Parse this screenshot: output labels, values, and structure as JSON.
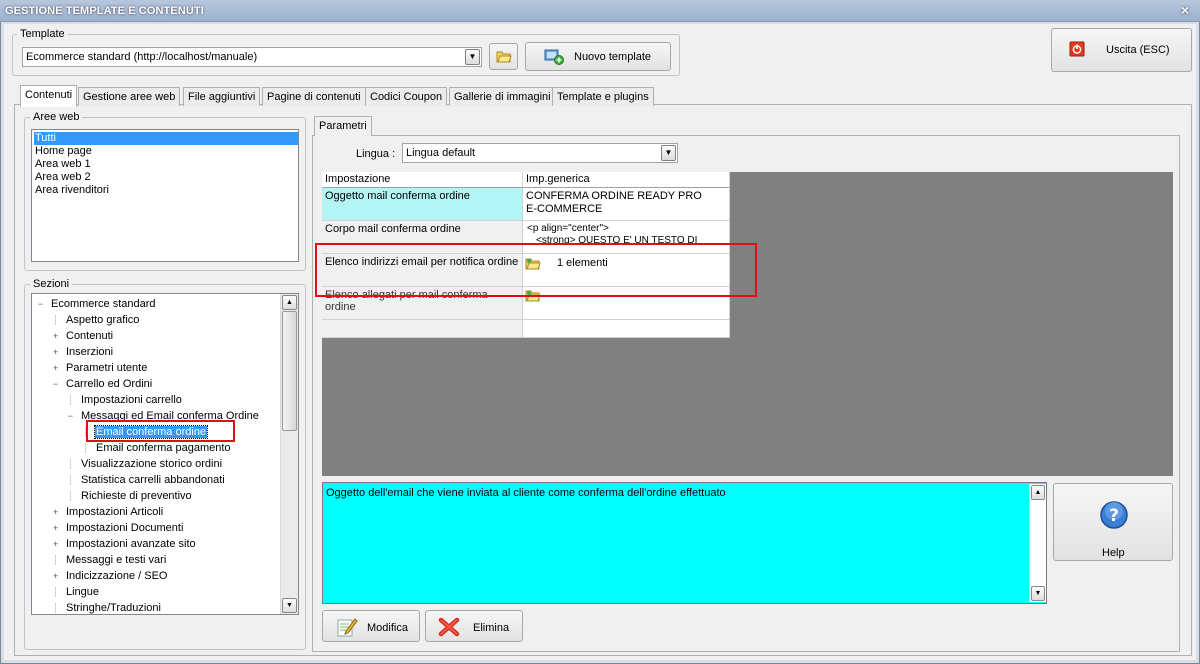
{
  "window": {
    "title": "GESTIONE TEMPLATE E CONTENUTI",
    "close": "×"
  },
  "template_group": {
    "label": "Template",
    "selected": "Ecommerce standard (http://localhost/manuale)",
    "new_button": "Nuovo template"
  },
  "exit_button": "Uscita (ESC)",
  "tabs": [
    {
      "label": "Contenuti",
      "active": true
    },
    {
      "label": "Gestione aree web"
    },
    {
      "label": "File aggiuntivi"
    },
    {
      "label": "Pagine di contenuti"
    },
    {
      "label": "Codici Coupon"
    },
    {
      "label": "Gallerie di immagini"
    },
    {
      "label": "Template e plugins"
    }
  ],
  "aree_web": {
    "label": "Aree web",
    "items": [
      "Tutti",
      "Home page",
      "Area web 1",
      "Area web 2",
      "Area rivenditori"
    ],
    "selected": "Tutti"
  },
  "sezioni": {
    "label": "Sezioni",
    "tree": [
      {
        "label": "Ecommerce standard",
        "exp": "−"
      },
      {
        "label": "Aspetto grafico",
        "exp": ""
      },
      {
        "label": "Contenuti",
        "exp": "+"
      },
      {
        "label": "Inserzioni",
        "exp": "+"
      },
      {
        "label": "Parametri utente",
        "exp": "+"
      },
      {
        "label": "Carrello ed Ordini",
        "exp": "−"
      },
      {
        "label": "Impostazioni carrello",
        "exp": ""
      },
      {
        "label": "Messaggi ed Email conferma Ordine",
        "exp": "−"
      },
      {
        "label": "Email conferma ordine",
        "exp": "",
        "selected": true
      },
      {
        "label": "Email conferma pagamento",
        "exp": ""
      },
      {
        "label": "Visualizzazione storico ordini",
        "exp": ""
      },
      {
        "label": "Statistica carrelli abbandonati",
        "exp": ""
      },
      {
        "label": "Richieste di preventivo",
        "exp": ""
      },
      {
        "label": "Impostazioni Articoli",
        "exp": "+"
      },
      {
        "label": "Impostazioni Documenti",
        "exp": "+"
      },
      {
        "label": "Impostazioni avanzate sito",
        "exp": "+"
      },
      {
        "label": "Messaggi e testi vari",
        "exp": ""
      },
      {
        "label": "Indicizzazione / SEO",
        "exp": "+"
      },
      {
        "label": "Lingue",
        "exp": ""
      },
      {
        "label": "Stringhe/Traduzioni",
        "exp": ""
      }
    ]
  },
  "parametri": {
    "tab_label": "Parametri",
    "lingua_label": "Lingua :",
    "lingua_value": "Lingua default",
    "grid": {
      "headers": [
        "Impostazione",
        "Imp.generica"
      ],
      "rows": [
        {
          "name": "Oggetto mail conferma ordine",
          "value_line1": "CONFERMA ORDINE READY PRO",
          "value_line2": "E-COMMERCE"
        },
        {
          "name": "Corpo mail conferma ordine",
          "value_line1": "<p align=\"center\">",
          "value_line2": "<strong> QUESTO E' UN TESTO DI"
        },
        {
          "name": "Elenco indirizzi email per notifica ordine",
          "value_line1": "1 elementi",
          "value_line2": ""
        },
        {
          "name": "Elenco allegati per mail conferma ordine",
          "value_line1": "",
          "value_line2": ""
        }
      ]
    },
    "description": "Oggetto dell'email che viene inviata al cliente come conferma dell'ordine effettuato"
  },
  "help_button": "Help",
  "modifica_button": "Modifica",
  "elimina_button": "Elimina",
  "colors": {
    "memo": "#00ffff",
    "highlight": "#e01010",
    "selection": "#3399ff",
    "grid_cyan": "#b3f4f4"
  }
}
